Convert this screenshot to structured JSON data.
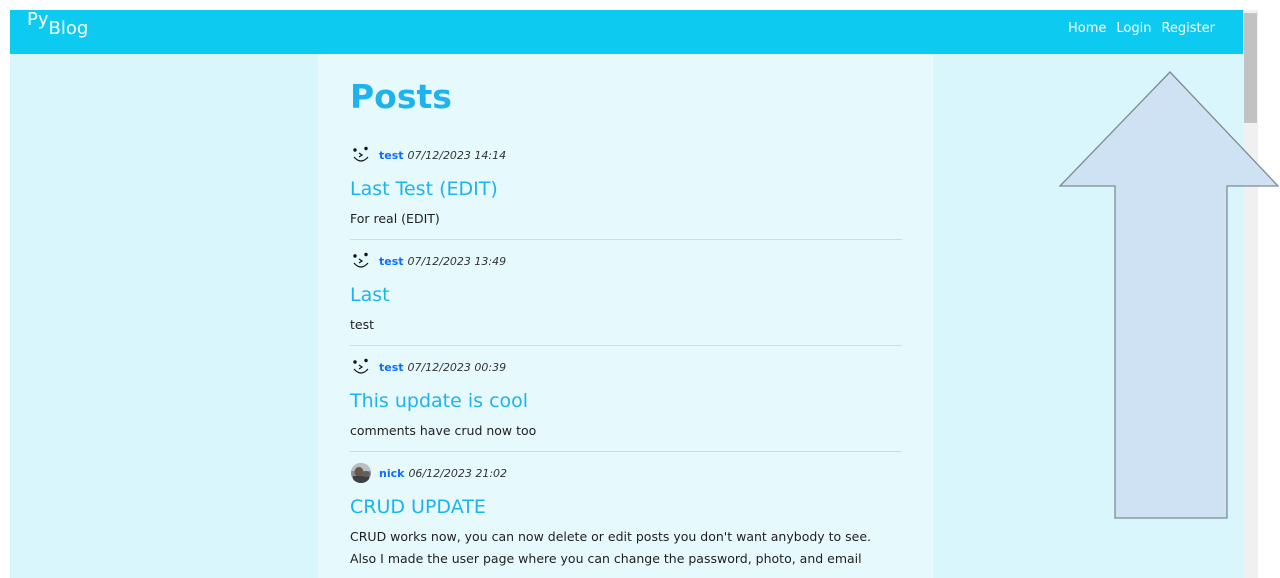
{
  "navbar": {
    "brand_prefix": "Py",
    "brand_suffix": "Blog",
    "links": [
      "Home",
      "Login",
      "Register"
    ]
  },
  "main": {
    "title": "Posts",
    "posts": [
      {
        "author": "test",
        "date": "07/12/2023 14:14",
        "title": "Last Test (EDIT)",
        "body": "For real (EDIT)"
      },
      {
        "author": "test",
        "date": "07/12/2023 13:49",
        "title": "Last",
        "body": "test"
      },
      {
        "author": "test",
        "date": "07/12/2023 00:39",
        "title": "This update is cool",
        "body": "comments have crud now too"
      },
      {
        "author": "nick",
        "date": "06/12/2023 21:02",
        "title": "CRUD UPDATE",
        "body": "CRUD works now, you can now delete or edit posts you don't want anybody to see. Also I made the user page where you can change the password, photo, and email"
      }
    ]
  },
  "colors": {
    "navbar": "#0dcaf0",
    "page_background": "#d8f6fb",
    "content_background": "#e6f9fd",
    "heading": "#1fb3ee",
    "author_link": "#0d6efd",
    "arrow_fill": "#cfe2f3"
  },
  "icons": {
    "avatar_default": "smiley-face-icon",
    "avatar_photo": "user-photo-icon",
    "overlay": "up-arrow-icon"
  }
}
